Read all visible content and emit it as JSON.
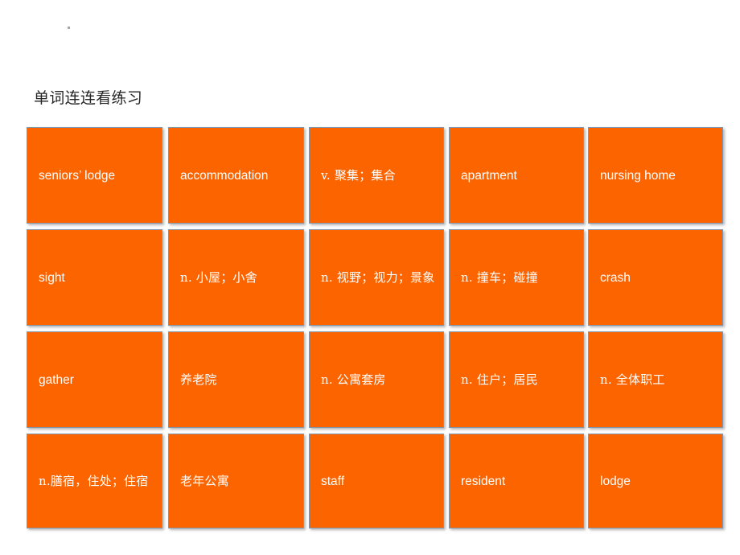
{
  "slide": {
    "title": "单词连连看练习",
    "background_color": "#ffffff",
    "mark": "."
  },
  "card_style": {
    "fill_color": "#fc6400",
    "border_color": "#8496ad",
    "text_color": "#ffffff"
  },
  "grid": {
    "rows": 4,
    "columns": 5,
    "cards": [
      [
        {
          "text": "seniors’ lodge",
          "script": "latin"
        },
        {
          "text": "accommodation",
          "script": "latin"
        },
        {
          "text": "v. 聚集；集合",
          "script": "cjk"
        },
        {
          "text": "apartment",
          "script": "latin"
        },
        {
          "text": "nursing home",
          "script": "latin"
        }
      ],
      [
        {
          "text": "sight",
          "script": "latin"
        },
        {
          "text": "n. 小屋；小舍",
          "script": "cjk"
        },
        {
          "text": "n. 视野；视力；景象",
          "script": "cjk"
        },
        {
          "text": "n. 撞车；碰撞",
          "script": "cjk"
        },
        {
          "text": "crash",
          "script": "latin"
        }
      ],
      [
        {
          "text": "gather",
          "script": "latin"
        },
        {
          "text": "养老院",
          "script": "cjk"
        },
        {
          "text": "n. 公寓套房",
          "script": "cjk"
        },
        {
          "text": "n. 住户；居民",
          "script": "cjk"
        },
        {
          "text": "n. 全体职工",
          "script": "cjk"
        }
      ],
      [
        {
          "text": "n.膳宿，住处；住宿",
          "script": "cjk"
        },
        {
          "text": "老年公寓",
          "script": "cjk"
        },
        {
          "text": "staff",
          "script": "latin"
        },
        {
          "text": "resident",
          "script": "latin"
        },
        {
          "text": "lodge",
          "script": "latin"
        }
      ]
    ]
  }
}
